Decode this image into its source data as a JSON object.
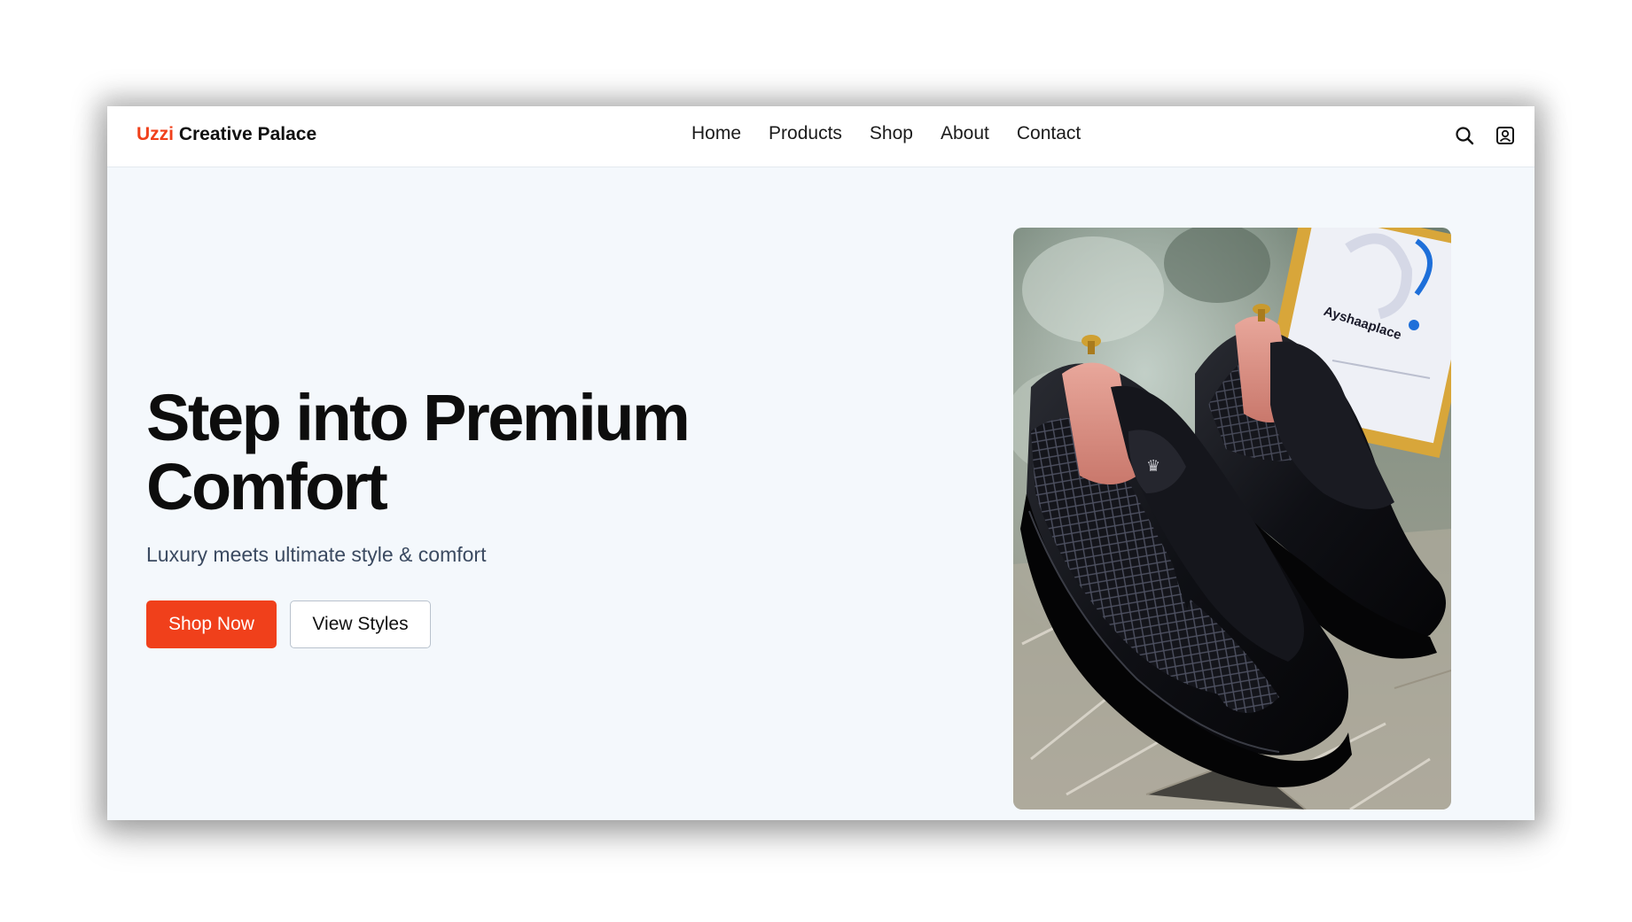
{
  "header": {
    "logo_accent": "Uzzi",
    "logo_rest": "Creative Palace",
    "nav": [
      "Home",
      "Products",
      "Shop",
      "About",
      "Contact"
    ],
    "icons": [
      "search-icon",
      "account-icon"
    ]
  },
  "hero": {
    "title_line1": "Step into Premium",
    "title_line2": "Comfort",
    "subtitle": "Luxury meets ultimate style & comfort",
    "primary_button": "Shop Now",
    "secondary_button": "View Styles",
    "image_sign_text": "Ayshaaplace"
  },
  "colors": {
    "accent": "#f0401b",
    "background": "#f4f8fc",
    "text": "#0d0d0d",
    "subtitle": "#3b4a61"
  }
}
